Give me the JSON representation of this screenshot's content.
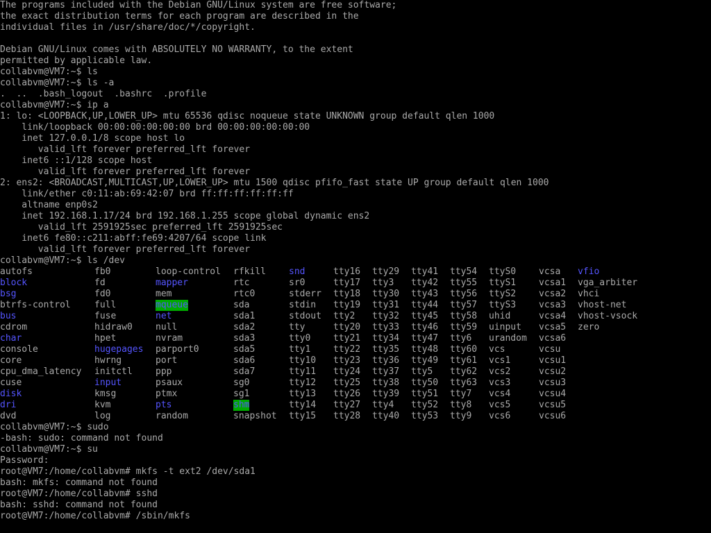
{
  "terminal": {
    "colors": {
      "background": "#000000",
      "foreground": "#aaaaaa",
      "directory": "#5555ff",
      "highlight_background": "#00aa00"
    },
    "intro_lines": [
      "The programs included with the Debian GNU/Linux system are free software;",
      "the exact distribution terms for each program are described in the",
      "individual files in /usr/share/doc/*/copyright.",
      "",
      "Debian GNU/Linux comes with ABSOLUTELY NO WARRANTY, to the extent",
      "permitted by applicable law.",
      "collabvm@VM7:~$ ls",
      "collabvm@VM7:~$ ls -a",
      ".  ..  .bash_logout  .bashrc  .profile",
      "collabvm@VM7:~$ ip a",
      "1: lo: <LOOPBACK,UP,LOWER_UP> mtu 65536 qdisc noqueue state UNKNOWN group default qlen 1000",
      "    link/loopback 00:00:00:00:00:00 brd 00:00:00:00:00:00",
      "    inet 127.0.0.1/8 scope host lo",
      "       valid_lft forever preferred_lft forever",
      "    inet6 ::1/128 scope host",
      "       valid_lft forever preferred_lft forever",
      "2: ens2: <BROADCAST,MULTICAST,UP,LOWER_UP> mtu 1500 qdisc pfifo_fast state UP group default qlen 1000",
      "    link/ether c0:11:ab:69:42:07 brd ff:ff:ff:ff:ff:ff",
      "    altname enp0s2",
      "    inet 192.168.1.17/24 brd 192.168.1.255 scope global dynamic ens2",
      "       valid_lft 2591925sec preferred_lft 2591925sec",
      "    inet6 fe80::c211:abff:fe69:4207/64 scope link",
      "       valid_lft forever preferred_lft forever",
      "collabvm@VM7:~$ ls /dev"
    ],
    "dev_listing": [
      [
        {
          "t": "autofs"
        },
        {
          "t": "fb0"
        },
        {
          "t": "loop-control"
        },
        {
          "t": "rfkill"
        },
        {
          "t": "snd",
          "k": "dir"
        },
        {
          "t": "tty16"
        },
        {
          "t": "tty29"
        },
        {
          "t": "tty41"
        },
        {
          "t": "tty54"
        },
        {
          "t": "ttyS0"
        },
        {
          "t": "vcsa"
        },
        {
          "t": "vfio",
          "k": "dir"
        }
      ],
      [
        {
          "t": "block",
          "k": "dir"
        },
        {
          "t": "fd"
        },
        {
          "t": "mapper",
          "k": "dir"
        },
        {
          "t": "rtc"
        },
        {
          "t": "sr0"
        },
        {
          "t": "tty17"
        },
        {
          "t": "tty3"
        },
        {
          "t": "tty42"
        },
        {
          "t": "tty55"
        },
        {
          "t": "ttyS1"
        },
        {
          "t": "vcsa1"
        },
        {
          "t": "vga_arbiter"
        }
      ],
      [
        {
          "t": "bsg",
          "k": "dir"
        },
        {
          "t": "fd0"
        },
        {
          "t": "mem"
        },
        {
          "t": "rtc0"
        },
        {
          "t": "stderr"
        },
        {
          "t": "tty18"
        },
        {
          "t": "tty30"
        },
        {
          "t": "tty43"
        },
        {
          "t": "tty56"
        },
        {
          "t": "ttyS2"
        },
        {
          "t": "vcsa2"
        },
        {
          "t": "vhci"
        }
      ],
      [
        {
          "t": "btrfs-control"
        },
        {
          "t": "full"
        },
        {
          "t": "mqueue",
          "k": "hl"
        },
        {
          "t": "sda"
        },
        {
          "t": "stdin"
        },
        {
          "t": "tty19"
        },
        {
          "t": "tty31"
        },
        {
          "t": "tty44"
        },
        {
          "t": "tty57"
        },
        {
          "t": "ttyS3"
        },
        {
          "t": "vcsa3"
        },
        {
          "t": "vhost-net"
        }
      ],
      [
        {
          "t": "bus",
          "k": "dir"
        },
        {
          "t": "fuse"
        },
        {
          "t": "net",
          "k": "dir"
        },
        {
          "t": "sda1"
        },
        {
          "t": "stdout"
        },
        {
          "t": "tty2"
        },
        {
          "t": "tty32"
        },
        {
          "t": "tty45"
        },
        {
          "t": "tty58"
        },
        {
          "t": "uhid"
        },
        {
          "t": "vcsa4"
        },
        {
          "t": "vhost-vsock"
        }
      ],
      [
        {
          "t": "cdrom"
        },
        {
          "t": "hidraw0"
        },
        {
          "t": "null"
        },
        {
          "t": "sda2"
        },
        {
          "t": "tty"
        },
        {
          "t": "tty20"
        },
        {
          "t": "tty33"
        },
        {
          "t": "tty46"
        },
        {
          "t": "tty59"
        },
        {
          "t": "uinput"
        },
        {
          "t": "vcsa5"
        },
        {
          "t": "zero"
        }
      ],
      [
        {
          "t": "char",
          "k": "dir"
        },
        {
          "t": "hpet"
        },
        {
          "t": "nvram"
        },
        {
          "t": "sda3"
        },
        {
          "t": "tty0"
        },
        {
          "t": "tty21"
        },
        {
          "t": "tty34"
        },
        {
          "t": "tty47"
        },
        {
          "t": "tty6"
        },
        {
          "t": "urandom"
        },
        {
          "t": "vcsa6"
        }
      ],
      [
        {
          "t": "console"
        },
        {
          "t": "hugepages",
          "k": "dir"
        },
        {
          "t": "parport0"
        },
        {
          "t": "sda5"
        },
        {
          "t": "tty1"
        },
        {
          "t": "tty22"
        },
        {
          "t": "tty35"
        },
        {
          "t": "tty48"
        },
        {
          "t": "tty60"
        },
        {
          "t": "vcs"
        },
        {
          "t": "vcsu"
        }
      ],
      [
        {
          "t": "core"
        },
        {
          "t": "hwrng"
        },
        {
          "t": "port"
        },
        {
          "t": "sda6"
        },
        {
          "t": "tty10"
        },
        {
          "t": "tty23"
        },
        {
          "t": "tty36"
        },
        {
          "t": "tty49"
        },
        {
          "t": "tty61"
        },
        {
          "t": "vcs1"
        },
        {
          "t": "vcsu1"
        }
      ],
      [
        {
          "t": "cpu_dma_latency"
        },
        {
          "t": "initctl"
        },
        {
          "t": "ppp"
        },
        {
          "t": "sda7"
        },
        {
          "t": "tty11"
        },
        {
          "t": "tty24"
        },
        {
          "t": "tty37"
        },
        {
          "t": "tty5"
        },
        {
          "t": "tty62"
        },
        {
          "t": "vcs2"
        },
        {
          "t": "vcsu2"
        }
      ],
      [
        {
          "t": "cuse"
        },
        {
          "t": "input",
          "k": "dir"
        },
        {
          "t": "psaux"
        },
        {
          "t": "sg0"
        },
        {
          "t": "tty12"
        },
        {
          "t": "tty25"
        },
        {
          "t": "tty38"
        },
        {
          "t": "tty50"
        },
        {
          "t": "tty63"
        },
        {
          "t": "vcs3"
        },
        {
          "t": "vcsu3"
        }
      ],
      [
        {
          "t": "disk",
          "k": "dir"
        },
        {
          "t": "kmsg"
        },
        {
          "t": "ptmx"
        },
        {
          "t": "sg1"
        },
        {
          "t": "tty13"
        },
        {
          "t": "tty26"
        },
        {
          "t": "tty39"
        },
        {
          "t": "tty51"
        },
        {
          "t": "tty7"
        },
        {
          "t": "vcs4"
        },
        {
          "t": "vcsu4"
        }
      ],
      [
        {
          "t": "dri",
          "k": "dir"
        },
        {
          "t": "kvm"
        },
        {
          "t": "pts",
          "k": "dir"
        },
        {
          "t": "shm",
          "k": "hl"
        },
        {
          "t": "tty14"
        },
        {
          "t": "tty27"
        },
        {
          "t": "tty4"
        },
        {
          "t": "tty52"
        },
        {
          "t": "tty8"
        },
        {
          "t": "vcs5"
        },
        {
          "t": "vcsu5"
        }
      ],
      [
        {
          "t": "dvd"
        },
        {
          "t": "log"
        },
        {
          "t": "random"
        },
        {
          "t": "snapshot"
        },
        {
          "t": "tty15"
        },
        {
          "t": "tty28"
        },
        {
          "t": "tty40"
        },
        {
          "t": "tty53"
        },
        {
          "t": "tty9"
        },
        {
          "t": "vcs6"
        },
        {
          "t": "vcsu6"
        }
      ]
    ],
    "outro_lines": [
      "collabvm@VM7:~$ sudo",
      "-bash: sudo: command not found",
      "collabvm@VM7:~$ su",
      "Password:",
      "root@VM7:/home/collabvm# mkfs -t ext2 /dev/sda1",
      "bash: mkfs: command not found",
      "root@VM7:/home/collabvm# sshd",
      "bash: sshd: command not found",
      "root@VM7:/home/collabvm# /sbin/mkfs"
    ]
  }
}
